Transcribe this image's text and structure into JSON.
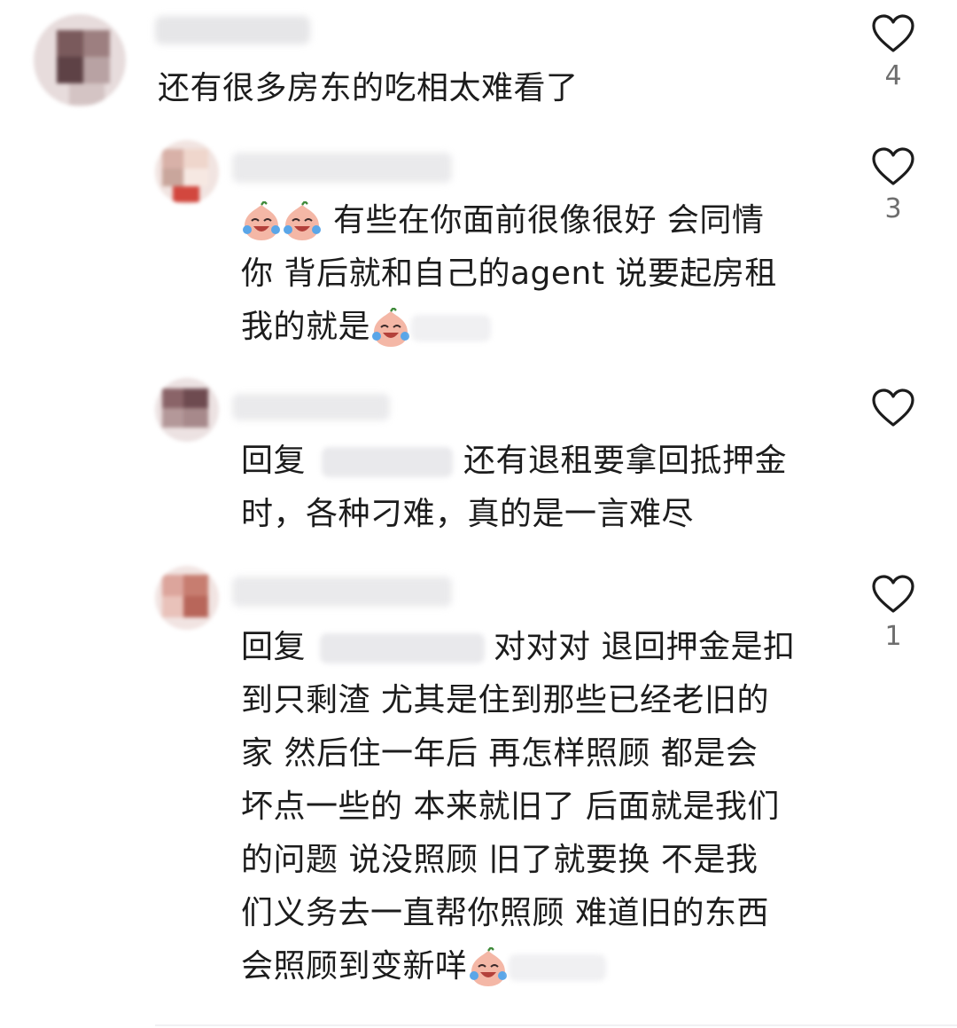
{
  "comments": [
    {
      "id": "c1",
      "text": "还有很多房东的吃相太难看了",
      "likes": "4"
    },
    {
      "id": "r1",
      "segments": [
        "有些在你面前很像很好 会同情",
        "你 背后就和自己的agent 说要起房租",
        "我的就是"
      ],
      "likes": "3"
    },
    {
      "id": "r2",
      "reply_prefix": "回复",
      "segments": [
        "还有退租要拿回抵押金",
        "时，各种刁难，真的是一言难尽"
      ],
      "likes": ""
    },
    {
      "id": "r3",
      "reply_prefix": "回复",
      "segments": [
        "对对对 退回押金是扣",
        "到只剩渣 尤其是住到那些已经老旧的",
        "家 然后住一年后 再怎样照顾 都是会",
        "坏点一些的 本来就旧了 后面就是我们",
        "的问题 说没照顾 旧了就要换 不是我",
        "们义务去一直帮你照顾 难道旧的东西",
        "会照顾到变新咩"
      ],
      "likes": "1"
    }
  ],
  "icons": {
    "like": "heart-outline-icon",
    "emoji": "crying-laughing-peach-emoji"
  },
  "colors": {
    "text": "#1c1c1c",
    "count": "#6e6e6e",
    "heart_stroke": "#1c1c1c"
  }
}
